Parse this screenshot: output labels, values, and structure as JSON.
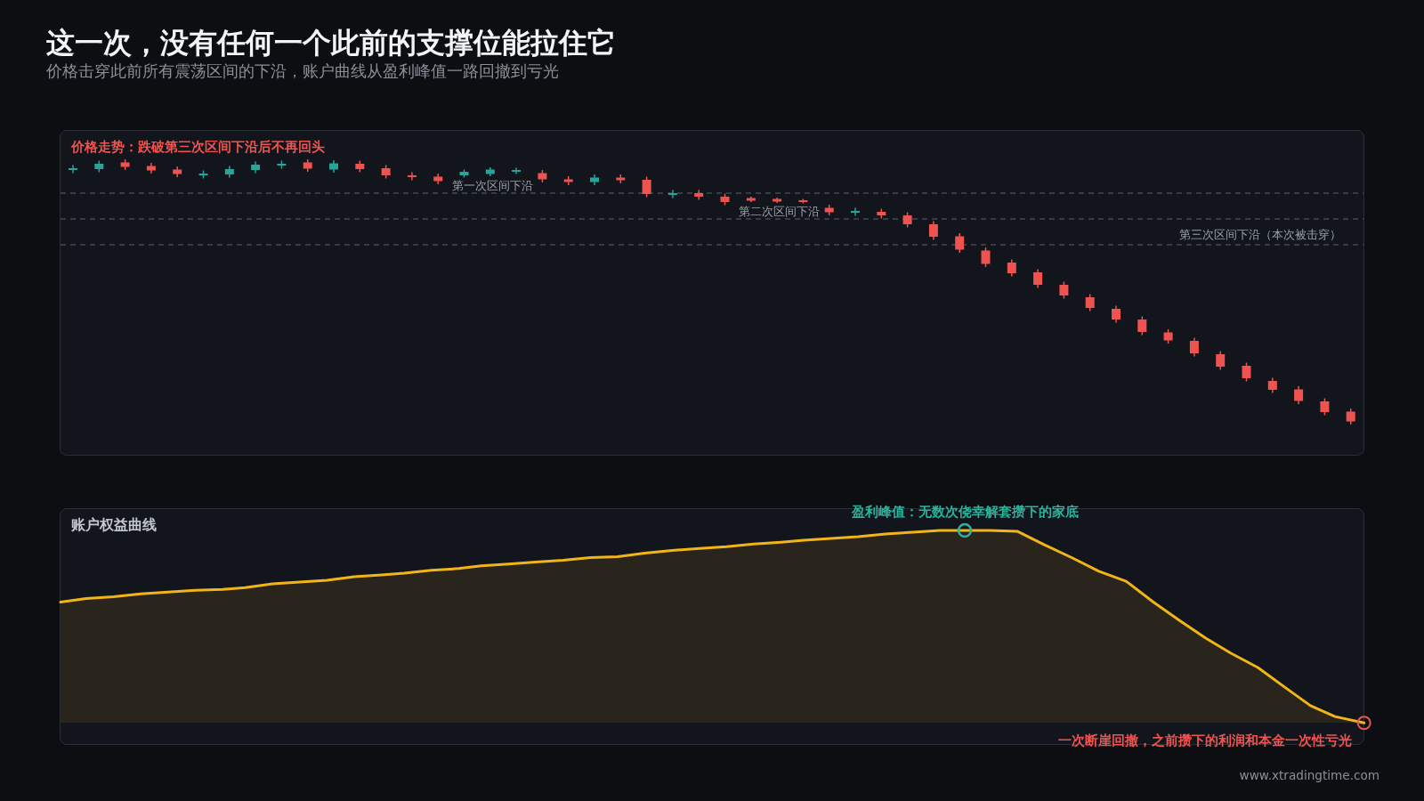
{
  "header": {
    "title": "这一次，没有任何一个此前的支撑位能拉住它",
    "subtitle": "价格击穿此前所有震荡区间的下沿，账户曲线从盈利峰值一路回撤到亏光"
  },
  "price_panel": {
    "title": "价格走势：跌破第三次区间下沿后不再回头",
    "levels": [
      {
        "label": "第一次区间下沿"
      },
      {
        "label": "第二次区间下沿"
      },
      {
        "label": "第三次区间下沿（本次被击穿）"
      }
    ]
  },
  "equity_panel": {
    "title": "账户权益曲线",
    "peak_label": "盈利峰值：无数次侥幸解套攒下的家底",
    "drawdown_label": "一次断崖回撤，之前攒下的利润和本金一次性亏光"
  },
  "footer": "www.xtradingtime.com"
}
